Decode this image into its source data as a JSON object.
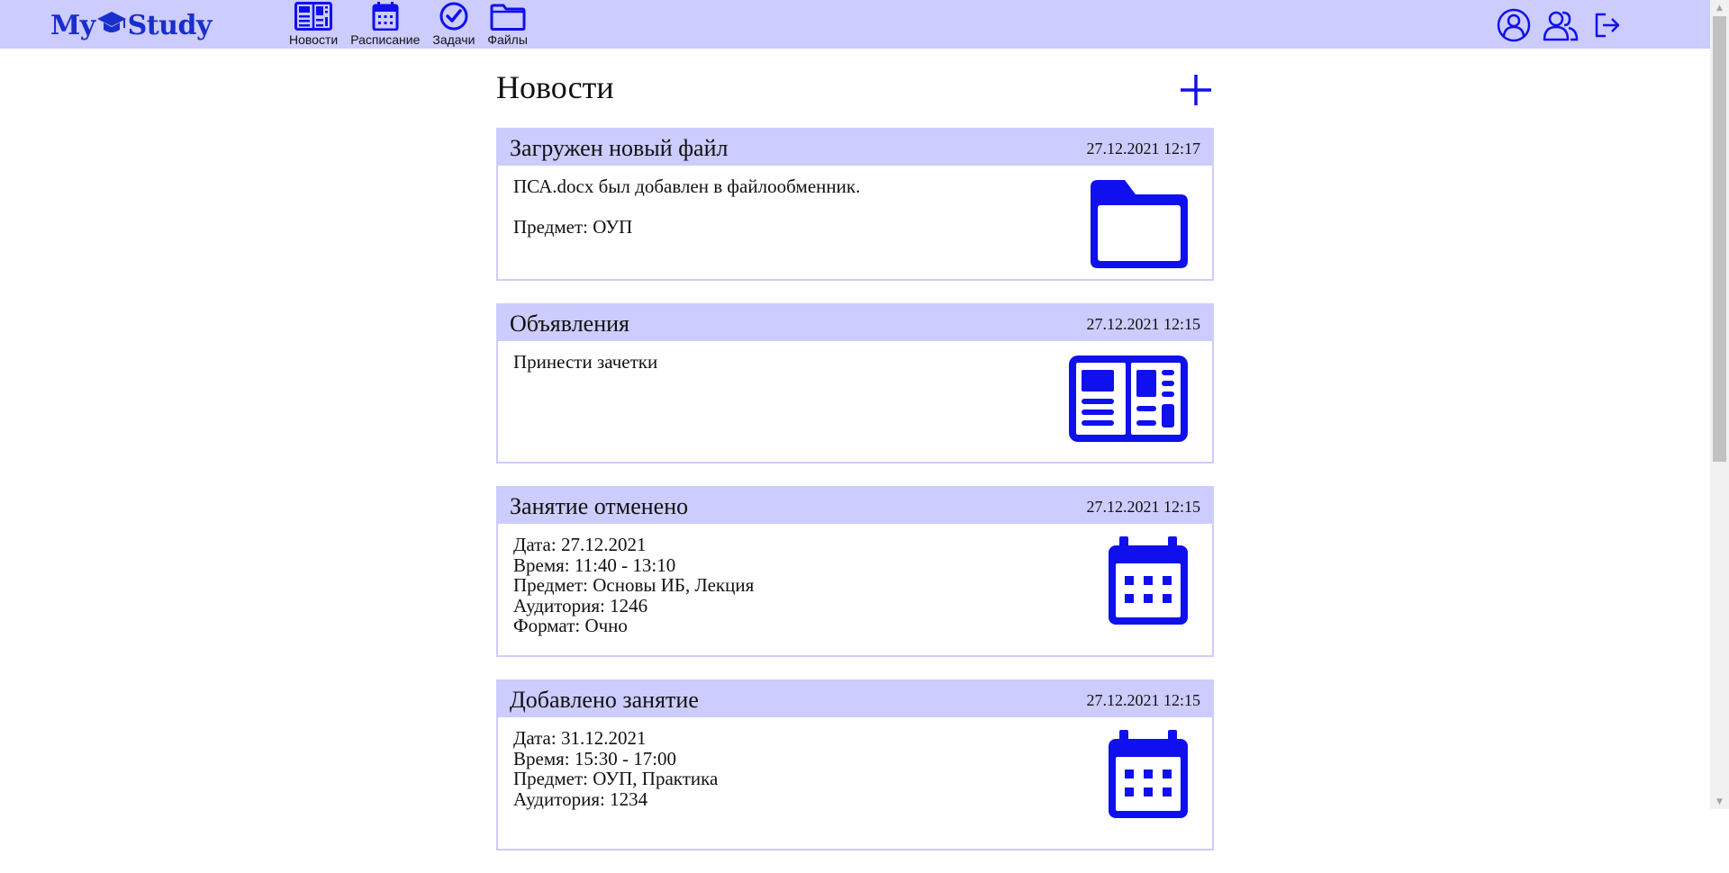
{
  "app": {
    "logo_left": "My",
    "logo_right": "Study"
  },
  "nav": {
    "items": [
      {
        "label": "Новости",
        "icon": "newspaper-icon"
      },
      {
        "label": "Расписание",
        "icon": "calendar-icon"
      },
      {
        "label": "Задачи",
        "icon": "check-circle-icon"
      },
      {
        "label": "Файлы",
        "icon": "folder-icon"
      }
    ]
  },
  "user_tools": {
    "icons": [
      "profile-icon",
      "users-icon",
      "logout-icon"
    ]
  },
  "colors": {
    "header_bg": "#ccccff",
    "accent": "#1010ee",
    "logo": "#1a2ecc"
  },
  "page": {
    "title": "Новости",
    "add_icon": "plus-icon"
  },
  "news": [
    {
      "title": "Загружен новый файл",
      "date": "27.12.2021 12:17",
      "icon": "folder-icon",
      "line1": "ПСА.docx был добавлен в файлообменник.",
      "line2": "Предмет: ОУП"
    },
    {
      "title": "Объявления",
      "date": "27.12.2021 12:15",
      "icon": "newspaper-icon",
      "line1": "Принести зачетки"
    },
    {
      "title": "Занятие отменено",
      "date": "27.12.2021 12:15",
      "icon": "calendar-icon",
      "lines": [
        "Дата: 27.12.2021",
        "Время: 11:40 - 13:10",
        "Предмет: Основы ИБ, Лекция",
        "Аудитория: 1246",
        "Формат: Очно"
      ]
    },
    {
      "title": "Добавлено занятие",
      "date": "27.12.2021 12:15",
      "icon": "calendar-icon",
      "lines": [
        "Дата: 31.12.2021",
        "Время: 15:30 - 17:00",
        "Предмет: ОУП, Практика",
        "Аудитория: 1234"
      ]
    }
  ]
}
